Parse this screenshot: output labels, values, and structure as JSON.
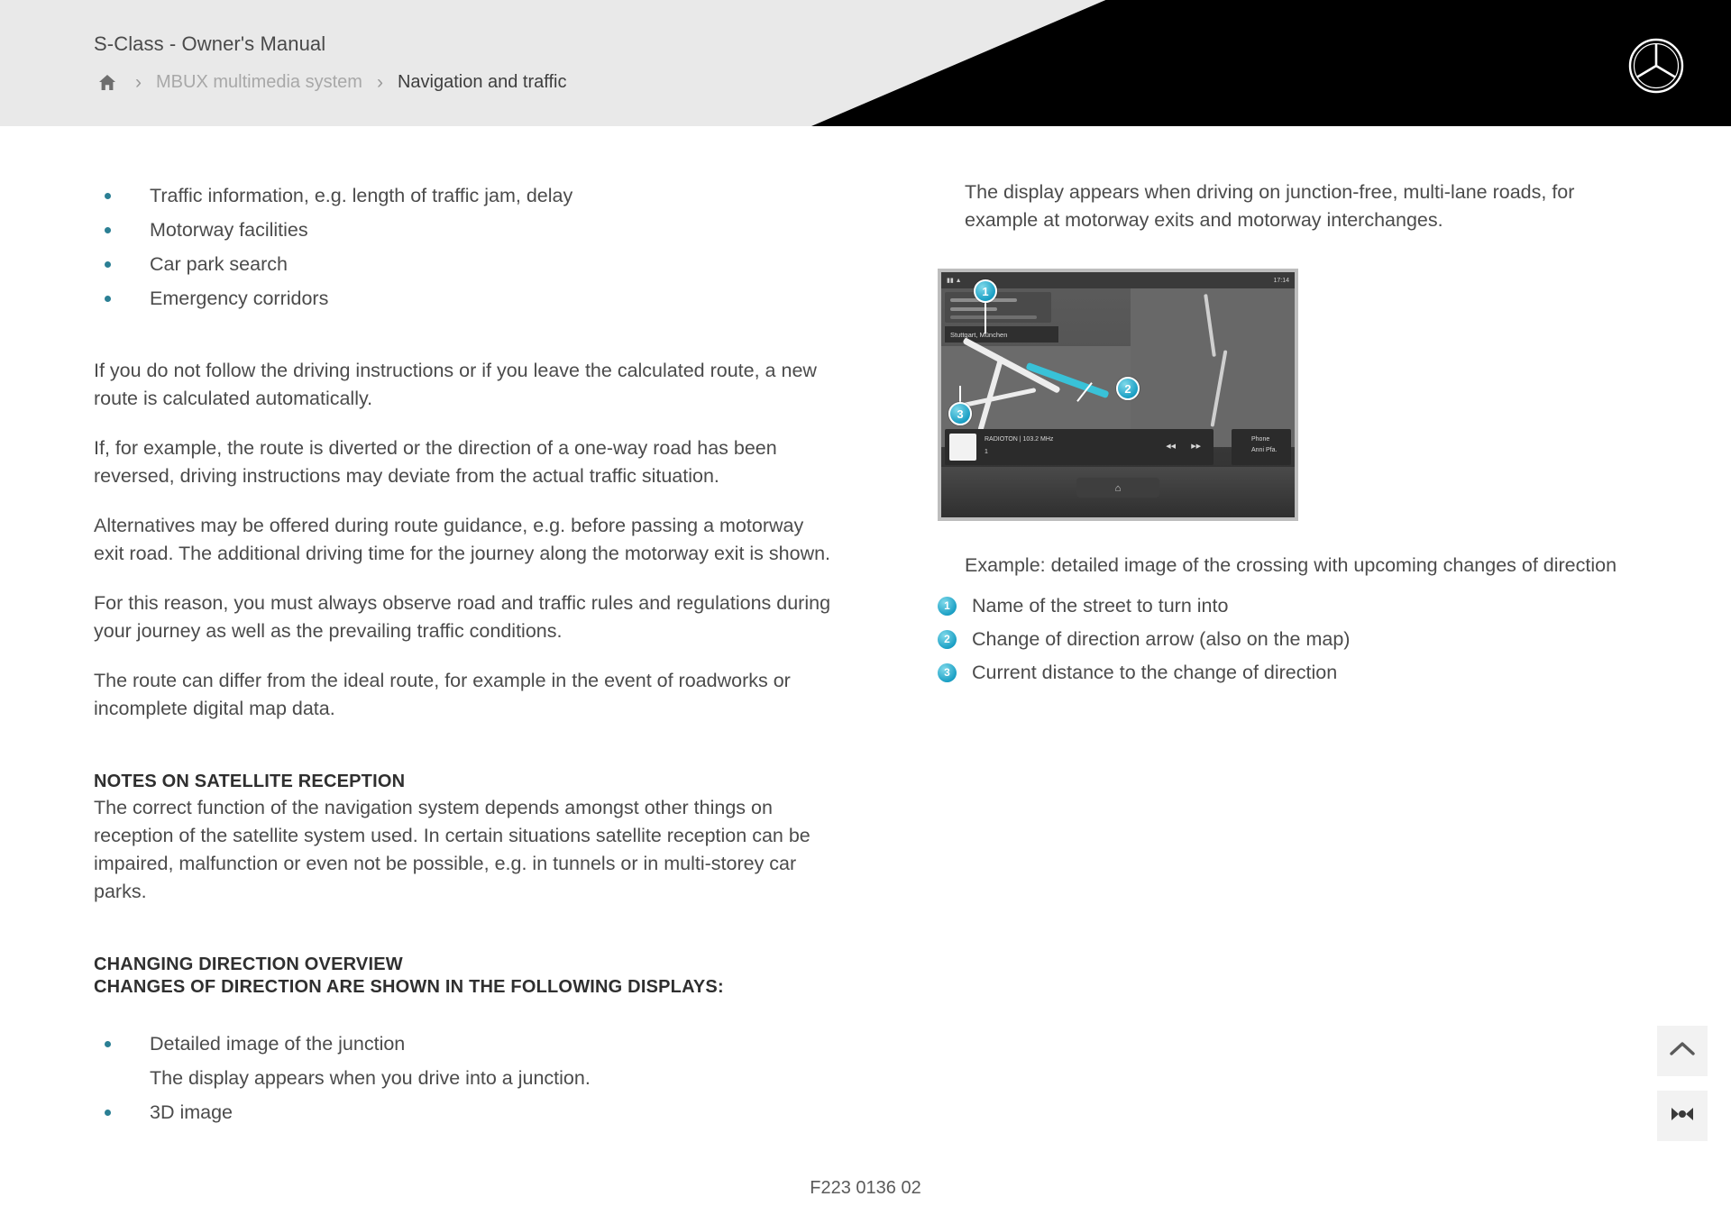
{
  "header": {
    "title": "S-Class - Owner's Manual",
    "breadcrumb": {
      "home_icon": "home-icon",
      "separator": "›",
      "parent": "MBUX multimedia system",
      "current": "Navigation and traffic"
    },
    "brand_logo": "mercedes-star-icon",
    "accent_color": "#1a9fc4",
    "header_bg": "#e9e9e9",
    "header_black": "#000000"
  },
  "left_column": {
    "top_bullets": [
      "Traffic information, e.g. length of traffic jam, delay",
      "Motorway facilities",
      "Car park search",
      "Emergency corridors"
    ],
    "paragraphs": [
      "If you do not follow the driving instructions or if you leave the calculated route, a new route is calculated automatically.",
      "If, for example, the route is diverted or the direction of a one-way road has been reversed, driving instructions may deviate from the actual traffic situation.",
      "Alternatives may be offered during route guidance, e.g. before passing a motorway exit road. The additional driving time for the journey along the motorway exit is shown.",
      "For this reason, you must always observe road and traffic rules and regulations during your journey as well as the prevailing traffic conditions.",
      "The route can differ from the ideal route, for example in the event of roadworks or incomplete digital map data."
    ],
    "satellite_heading": "NOTES ON SATELLITE RECEPTION",
    "satellite_body": "The correct function of the navigation system depends amongst other things on reception of the satellite system used. In certain situations satellite reception can be impaired, malfunction or even not be possible, e.g. in tunnels or in multi-storey car parks.",
    "overview_heading": "CHANGING DIRECTION OVERVIEW",
    "overview_subheading": "CHANGES OF DIRECTION ARE SHOWN IN THE FOLLOWING DISPLAYS:",
    "bottom_bullets": [
      "Detailed image of the junction",
      "3D image"
    ],
    "bottom_sub_line": "The display appears when you drive into a junction."
  },
  "right_column": {
    "intro": "The display appears when driving on junction-free, multi-lane roads, for example at motorway exits and motorway interchanges.",
    "caption": "Example: detailed image of the crossing with upcoming changes of direction",
    "legend": [
      {
        "number": "1",
        "label": "Name of the street to turn into"
      },
      {
        "number": "2",
        "label": "Change of direction arrow (also on the map)"
      },
      {
        "number": "3",
        "label": "Current distance to the change of direction"
      }
    ],
    "screenshot": {
      "name": "mbux-navigation-screenshot",
      "callouts": [
        "1",
        "2",
        "3"
      ],
      "status_time": "17:14",
      "street_label": "Stuttgart, München",
      "radio_label": "RADIOTON | 103.2 MHz",
      "radio_station": "1",
      "phone_label": "Phone",
      "phone_sub": "Anni Pfa."
    }
  },
  "footer": {
    "page_code": "F223 0136 02",
    "scroll_top_icon": "chevron-up-icon",
    "glossary_icon": "glossary-icon"
  }
}
